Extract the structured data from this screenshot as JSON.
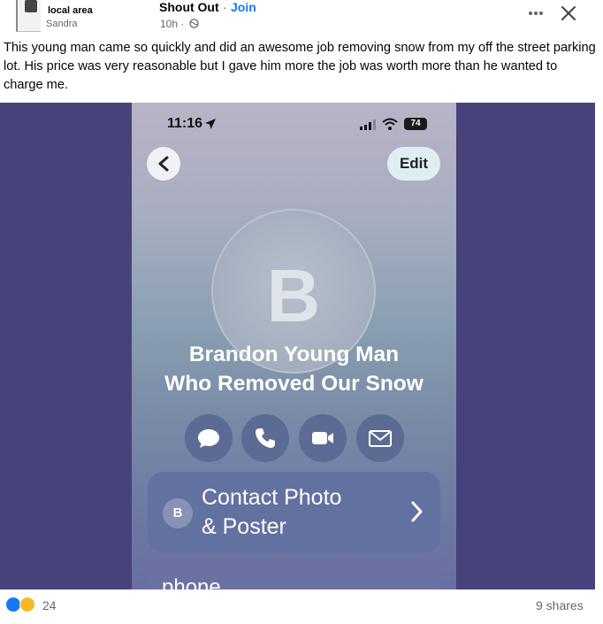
{
  "post": {
    "group_name": "local area",
    "author": "Sandra",
    "title": "Shout Out",
    "separator": "·",
    "join_label": "Join",
    "time": "10h ·",
    "text": "This young man came so quickly and did an awesome job removing snow from my off the street parking lot. His price was very reasonable but I gave him more the job was worth more than he wanted to charge me."
  },
  "screenshot": {
    "status_time": "11:16",
    "battery": "74",
    "edit_label": "Edit",
    "avatar_letter": "B",
    "contact_name_line1": "Brandon Young Man",
    "contact_name_line2": "Who Removed Our Snow",
    "poster_badge": "B",
    "poster_label_line1": "Contact Photo",
    "poster_label_line2": "& Poster",
    "phone_label": "phone"
  },
  "footer": {
    "reaction_count": "24",
    "shares": "9 shares"
  },
  "colors": {
    "background_frame": "#48427c",
    "link": "#1877f2",
    "secondary_text": "#65676b"
  }
}
